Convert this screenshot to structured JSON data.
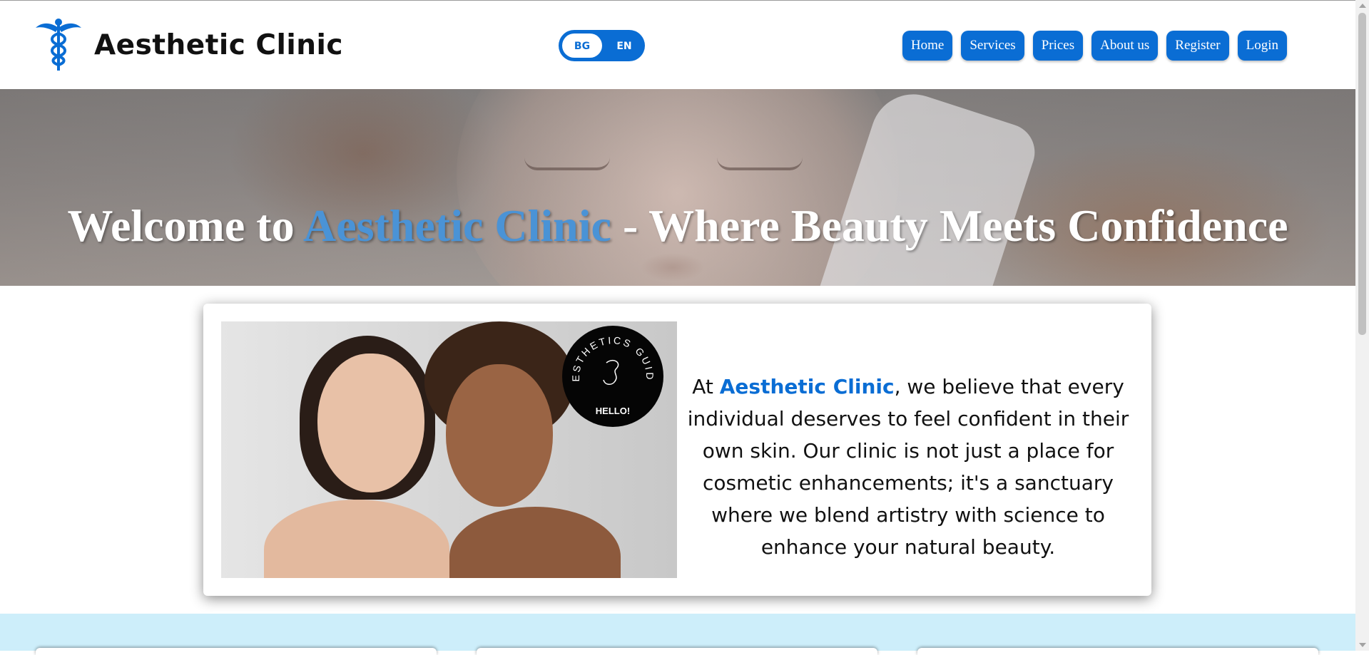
{
  "header": {
    "brand_title": "Aesthetic Clinic",
    "logo_icon": "caduceus-icon",
    "language": {
      "bg_label": "BG",
      "en_label": "EN",
      "active": "EN"
    },
    "nav": [
      {
        "label": "Home"
      },
      {
        "label": "Services"
      },
      {
        "label": "Prices"
      },
      {
        "label": "About us"
      },
      {
        "label": "Register"
      },
      {
        "label": "Login"
      }
    ]
  },
  "hero": {
    "title_prefix": "Welcome to ",
    "title_accent": "Aesthetic Clinic",
    "title_suffix": " - Where Beauty Meets Confidence"
  },
  "intro": {
    "badge_arc_text": "AESTHETICS GUIDE",
    "badge_hello": "HELLO!",
    "text_prefix": "At ",
    "text_accent": "Aesthetic Clinic",
    "text_suffix": ", we believe that every individual deserves to feel confident in their own skin. Our clinic is not just a place for cosmetic enhancements; it's a sanctuary where we blend artistry with science to enhance your natural beauty."
  },
  "colors": {
    "accent": "#0a6dd4",
    "hero_accent": "#4a93d6",
    "section_bg": "#cdeefa"
  }
}
